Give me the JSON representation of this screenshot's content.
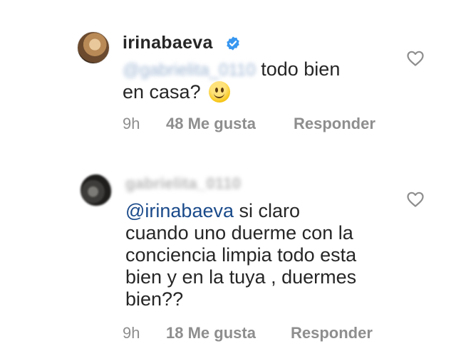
{
  "comments": [
    {
      "username": "irinabaeva",
      "verified": true,
      "mention": "@gabrielita_0110",
      "text_line1": "todo bien",
      "text_line2": "en casa?",
      "emoji": "slightly-smiling-face",
      "time": "9h",
      "likes": "48 Me gusta",
      "reply": "Responder"
    },
    {
      "username": "gabrielita_0110",
      "verified": false,
      "mention": "@irinabaeva",
      "text_lines": [
        "si claro",
        "cuando uno duerme con la",
        "conciencia limpia todo esta",
        "bien y en la tuya , duermes",
        "bien??"
      ],
      "time": "9h",
      "likes": "18 Me gusta",
      "reply": "Responder"
    }
  ],
  "colors": {
    "text": "#262626",
    "muted": "#8e8e8e",
    "mention": "#1a4a8a",
    "verified": "#3897f0"
  }
}
